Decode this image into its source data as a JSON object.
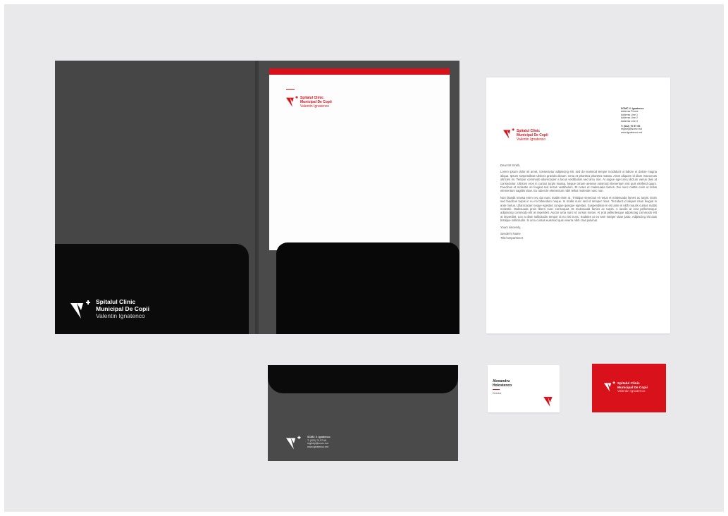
{
  "colors": {
    "brand_red": "#d8111b",
    "folder_gray": "#464646",
    "pocket_black": "#0b0b0b",
    "backdrop": "#e9e9eb"
  },
  "brand": {
    "line1": "Spitalul Clinic",
    "line2": "Municipal De Copii",
    "line3": "Valentin Ignatenco",
    "logo_icon": "v-plus-logo-icon"
  },
  "letter": {
    "address": {
      "company": "SCMC V. Ignatenco",
      "name": "Address Phone",
      "line1": "Address Line 1",
      "line2": "Address Line 2",
      "line3": "Address Line 3",
      "phone": "T: (022) 70 57 66",
      "email": "registry@scmc.md",
      "web": "www.ignatenco.md"
    },
    "greeting": "Dear Mr Smith,",
    "paragraph1": "Lorem ipsum dolor sit amet, consectetur adipiscing elit, sed do eiusmod tempor incididunt ut labore et dolore magna aliqua. Ipsum suspendisse ultrices gravida dictum. Urna et pharetra pharetra massa. Amet aliquam id diam maecenas ultricies mi. Tempor commodo ullamcorper a lacus vestibulum sed arcu non. At augue eget arcu dictum varius duis at consectetur. Ultrices eros in cursus turpis massa. Neque ornare aenean euismod elementum nisi quis eleifend quam. Faucibus et molestie ac feugiat sed lectus vestibulum. Et netus et malesuada fames. Dui nunc mattis enim ut tellus elementum sagittis vitae. Eu tubercle elementum nibh tellus molestie nunc non.",
    "paragraph2": "Non blandit massa enim nec dui nunc mattis enim ut. Tristique senectus et netus et malesuada fames ac turpis. Enim sed faucibus turpis in eu mi bibendum neque. In mollis nunc sed id semper risus. Tincidunt id aliquet risus feugiat in ante metus. Ullamcorper neque egestas congue quisque egestas. Suspendisse in est ante in nibh mauris cursus mattis molestie. Malesuada proin libero nunc consequat. Et malesuada fames ac turpis. A iaculis at erat pellentesque adipiscing commodo elit at imperdiet. Auctor urna nunc id cursus metus. At erat pellentesque adipiscing commodo elit at imperdiet. Leo a diam sollicitudin tempor id eu nisl nunc. Sodales ut eu sem integer vitae justo. Adipiscing elit duis tristique sollicitudin. In arcu cursus euismod quis viverra nibh cras pulvinar.",
    "closing": "Yours sincerely,",
    "sender_name": "Sender's Name",
    "sender_title": "Title/ Department"
  },
  "envelope": {
    "company": "SCMC V. Ignatenco",
    "phone": "T: (022) 70 57 66",
    "email": "registry@scmc.md",
    "web": "www.ignatenco.md"
  },
  "business_card": {
    "first_name": "Alexandru",
    "last_name": "Holostenco",
    "title": "Director"
  }
}
